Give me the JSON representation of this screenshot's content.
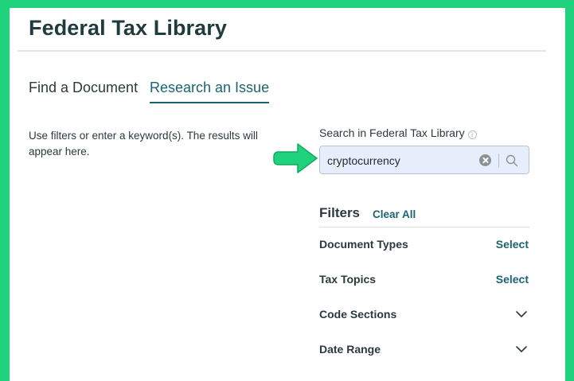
{
  "header": {
    "title": "Federal Tax Library"
  },
  "tabs": [
    {
      "label": "Find a Document",
      "active": false
    },
    {
      "label": "Research an Issue",
      "active": true
    }
  ],
  "main": {
    "hint_text": "Use filters or enter a keyword(s). The results will appear here."
  },
  "search": {
    "label": "Search in Federal Tax Library",
    "info_icon": "i",
    "value": "cryptocurrency",
    "icons": [
      "info-icon",
      "clear-icon",
      "search-icon"
    ]
  },
  "filters": {
    "title": "Filters",
    "clear_all_label": "Clear All",
    "items": [
      {
        "label": "Document Types",
        "action": "Select"
      },
      {
        "label": "Tax Topics",
        "action": "Select"
      },
      {
        "label": "Code Sections",
        "action": "chevron-down-icon"
      },
      {
        "label": "Date Range",
        "action": "chevron-down-icon"
      }
    ]
  },
  "annotation": {
    "arrow_icon": "arrow-right-icon",
    "color": "#1ed37c"
  },
  "colors": {
    "accent": "#1b6470",
    "border": "#1ed37c",
    "search_bg": "#e6eefb"
  }
}
